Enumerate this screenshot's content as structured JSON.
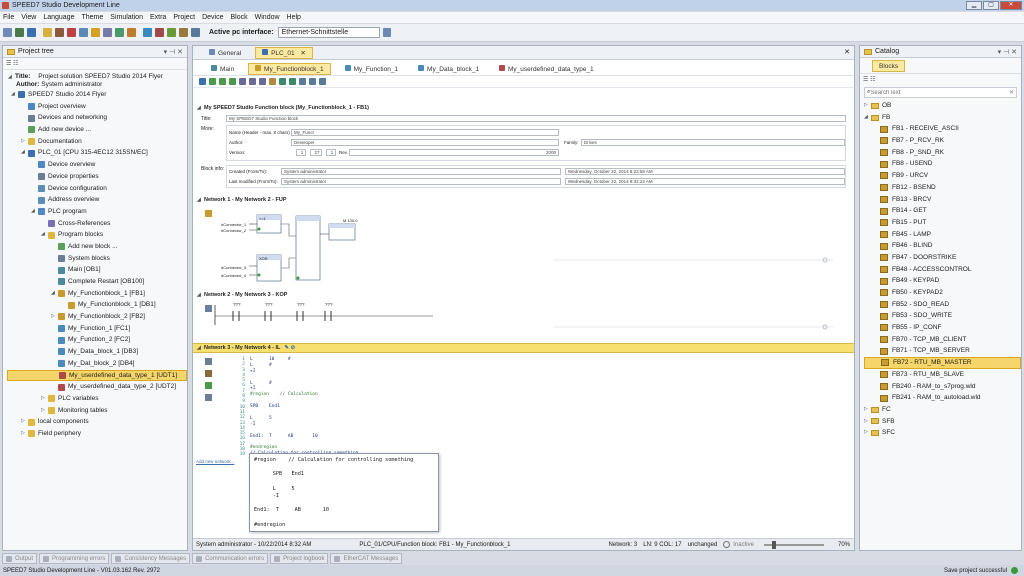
{
  "window": {
    "title": "SPEED7 Studio Development Line",
    "min_label": "▁",
    "max_label": "▢",
    "close_label": "✕"
  },
  "menu": [
    "File",
    "View",
    "Language",
    "Theme",
    "Simulation",
    "Extra",
    "Project",
    "Device",
    "Block",
    "Window",
    "Help"
  ],
  "toolbar": {
    "active_pc_label": "Active pc interface:",
    "interface_value": "Ethernet-Schnittstelle"
  },
  "project_tree": {
    "title": "Project tree",
    "meta_title_label": "Title:",
    "meta_title_value": "Project solution SPEED7 Studio 2014 Flyer",
    "meta_author_label": "Author:",
    "meta_author_value": "System administrator",
    "items": [
      {
        "label": "SPEED7 Studio 2014 Flyer",
        "indent": 1,
        "exp": "◢",
        "icon": "#3a6fb0"
      },
      {
        "label": "Project overview",
        "indent": 2,
        "exp": "",
        "icon": "#4f86c6"
      },
      {
        "label": "Devices and networking",
        "indent": 2,
        "exp": "",
        "icon": "#6a7f96"
      },
      {
        "label": "Add new device ...",
        "indent": 2,
        "exp": "",
        "icon": "#5aa05a"
      },
      {
        "label": "Documentation",
        "indent": 2,
        "exp": "▷",
        "icon": "#e0b840"
      },
      {
        "label": "PLC_01 [CPU 315-4EC12 315SN/EC]",
        "indent": 2,
        "exp": "◢",
        "icon": "#3a6fb0"
      },
      {
        "label": "Device overview",
        "indent": 3,
        "exp": "",
        "icon": "#4f86c6"
      },
      {
        "label": "Device properties",
        "indent": 3,
        "exp": "",
        "icon": "#6a7f96"
      },
      {
        "label": "Device configuration",
        "indent": 3,
        "exp": "",
        "icon": "#5a8fb8"
      },
      {
        "label": "Address overview",
        "indent": 3,
        "exp": "",
        "icon": "#5a8fb8"
      },
      {
        "label": "PLC program",
        "indent": 3,
        "exp": "◢",
        "icon": "#4f86c6"
      },
      {
        "label": "Cross-References",
        "indent": 4,
        "exp": "",
        "icon": "#7a6fb0"
      },
      {
        "label": "Program blocks",
        "indent": 4,
        "exp": "◢",
        "icon": "#e0b840"
      },
      {
        "label": "Add new block ...",
        "indent": 5,
        "exp": "",
        "icon": "#5aa05a"
      },
      {
        "label": "System blocks",
        "indent": 5,
        "exp": "",
        "icon": "#6a7f96"
      },
      {
        "label": "Main [OB1]",
        "indent": 5,
        "exp": "",
        "icon": "#4a8a9a"
      },
      {
        "label": "Complete Restart [OB100]",
        "indent": 5,
        "exp": "",
        "icon": "#4a8a9a"
      },
      {
        "label": "My_Functionblock_1 [FB1]",
        "indent": 5,
        "exp": "◢",
        "icon": "#c99a2e"
      },
      {
        "label": "My_Functionblock_1 [DB1]",
        "indent": 6,
        "exp": "",
        "icon": "#c99a2e"
      },
      {
        "label": "My_Functionblock_2 [FB2]",
        "indent": 5,
        "exp": "▷",
        "icon": "#c99a2e"
      },
      {
        "label": "My_Function_1 [FC1]",
        "indent": 5,
        "exp": "",
        "icon": "#4a8ab8"
      },
      {
        "label": "My_Function_2 [FC2]",
        "indent": 5,
        "exp": "",
        "icon": "#4a8ab8"
      },
      {
        "label": "My_Data_block_1 [DB3]",
        "indent": 5,
        "exp": "",
        "icon": "#4a8ab8"
      },
      {
        "label": "My_Dat_block_2 [DB4]",
        "indent": 5,
        "exp": "",
        "icon": "#4a8ab8"
      },
      {
        "label": "My_userdefined_data_type_1 [UDT1]",
        "indent": 5,
        "exp": "",
        "icon": "#b04a4a",
        "selected": true
      },
      {
        "label": "My_userdefined_data_type_2 [UDT2]",
        "indent": 5,
        "exp": "",
        "icon": "#b04a4a"
      },
      {
        "label": "PLC variables",
        "indent": 4,
        "exp": "▷",
        "icon": "#e0b840"
      },
      {
        "label": "Monitoring tables",
        "indent": 4,
        "exp": "▷",
        "icon": "#e0b840"
      },
      {
        "label": "local components",
        "indent": 2,
        "exp": "▷",
        "icon": "#e0b840"
      },
      {
        "label": "Field periphery",
        "indent": 2,
        "exp": "▷",
        "icon": "#e0b840"
      }
    ]
  },
  "editor": {
    "doc_tabs": [
      "General",
      "PLC_01"
    ],
    "block_tabs": [
      "Main",
      "My_Functionblock_1",
      "My_Function_1",
      "My_Data_block_1",
      "My_userdefined_data_type_1"
    ],
    "header_title": "My SPEED7 Studio Function block (My_Functionblock_1 - FB1)",
    "title_label": "Title:",
    "title_value": "My SPEED7 Studio Function block",
    "more_label": "More:",
    "name_label": "Name (Header - max. 8 chars)",
    "name_value": "My_Funct",
    "author_label": "Author:",
    "author_value": "Developer",
    "family_label": "Family:",
    "family_value": "Drives",
    "version_label": "Version:",
    "version_major": "1",
    "version_minor": "27",
    "version_patch": "1",
    "rev_label": "Rev.",
    "rev_value": "2000",
    "blockinfo_label": "Block info:",
    "created_label": "Created (From/To):",
    "created_from": "System administrator",
    "created_to": "Wednesday, October 22, 2014 8:23:58 AM",
    "modified_label": "Last modified (From/To):",
    "modified_from": "System administrator",
    "modified_to": "Wednesday, October 22, 2014 8:32:22 AM",
    "net1_title": "Network 1 - My Network 2 - FUP",
    "net1_conn": [
      "#Connector_1",
      "#Connector_2",
      "#Connector_3",
      "#Connector_4"
    ],
    "net1_gate1": ">=1",
    "net1_gate2": "XOR",
    "net1_value": "M 100.0",
    "net2_title": "Network 2 - My Network 3 - KOP",
    "net2_contacts": [
      "???",
      "???",
      "???",
      "???"
    ],
    "net3_title": "Network 3 - My Network 4 - IL",
    "line_numbers": [
      "1",
      "2",
      "3",
      "4",
      "5",
      "6",
      "7",
      "8",
      "9",
      "10",
      "11",
      "12",
      "13",
      "14",
      "15",
      "16",
      "17",
      "18",
      "19"
    ],
    "code_lines": [
      "L      10     #",
      "L      #",
      "+I",
      "",
      "L      #",
      "+I",
      "#region    // Calculation",
      "",
      "SPB    End1",
      "",
      "L      5",
      "-I",
      "",
      "End1:  T      AB       10",
      "",
      "#endregion",
      "// Calculation for controlling something"
    ],
    "add_network_label": "Add new network...",
    "tooltip_lines": [
      "#region    // Calculation for controlling something",
      "",
      "      SPB   End1",
      "",
      "      L     5",
      "      -I",
      "",
      "End1:  T     AB       10",
      "",
      "#endregion"
    ]
  },
  "status": {
    "user_time": "System administrator - 10/22/2014 8:32 AM",
    "path": "PLC_01/CPU/Function block: FB1 - My_Functionblock_1",
    "network": "Network: 3",
    "ln_col": "LN: 9 COL: 17",
    "state": "unchanged",
    "mode": "Inactive",
    "zoom": "70%"
  },
  "catalog": {
    "title": "Catalog",
    "tab": "Blocks",
    "search_placeholder": "SearchText",
    "groups_top": [
      "OB",
      "FB"
    ],
    "fb_items": [
      {
        "label": "FB1  - RECEIVE_ASCII"
      },
      {
        "label": "FB7  - P_RCV_RK"
      },
      {
        "label": "FB8  - P_SND_RK"
      },
      {
        "label": "FB8  - USEND"
      },
      {
        "label": "FB9  - URCV"
      },
      {
        "label": "FB12 - BSEND"
      },
      {
        "label": "FB13 - BRCV"
      },
      {
        "label": "FB14 - GET"
      },
      {
        "label": "FB15 - PUT"
      },
      {
        "label": "FB45 - LAMP"
      },
      {
        "label": "FB46 - BLIND"
      },
      {
        "label": "FB47 - DOORSTRIKE"
      },
      {
        "label": "FB48 - ACCESSCONTROL"
      },
      {
        "label": "FB49 - KEYPAD"
      },
      {
        "label": "FB50 - KEYPAD2"
      },
      {
        "label": "FB52 - SDO_READ"
      },
      {
        "label": "FB53 - SDO_WRITE"
      },
      {
        "label": "FB55 - IP_CONF"
      },
      {
        "label": "FB70 - TCP_MB_CLIENT"
      },
      {
        "label": "FB71 - TCP_MB_SERVER"
      },
      {
        "label": "FB72 - RTU_MB_MASTER",
        "selected": true
      },
      {
        "label": "FB73 - RTU_MB_SLAVE"
      },
      {
        "label": "FB240 - RAM_to_s7prog.wld"
      },
      {
        "label": "FB241 - RAM_to_autoload.wld"
      }
    ],
    "groups_bottom": [
      "FC",
      "SFB",
      "SFC"
    ]
  },
  "bottom_tabs": [
    "Output",
    "Programming errors",
    "Consistency Messages",
    "Communication errors",
    "Project logbook",
    "EtherCAT Messages"
  ],
  "footer": {
    "version": "SPEED7 Studio Development Line - V01.03.162 Rev. 2972",
    "save_status": "Save project successful"
  }
}
